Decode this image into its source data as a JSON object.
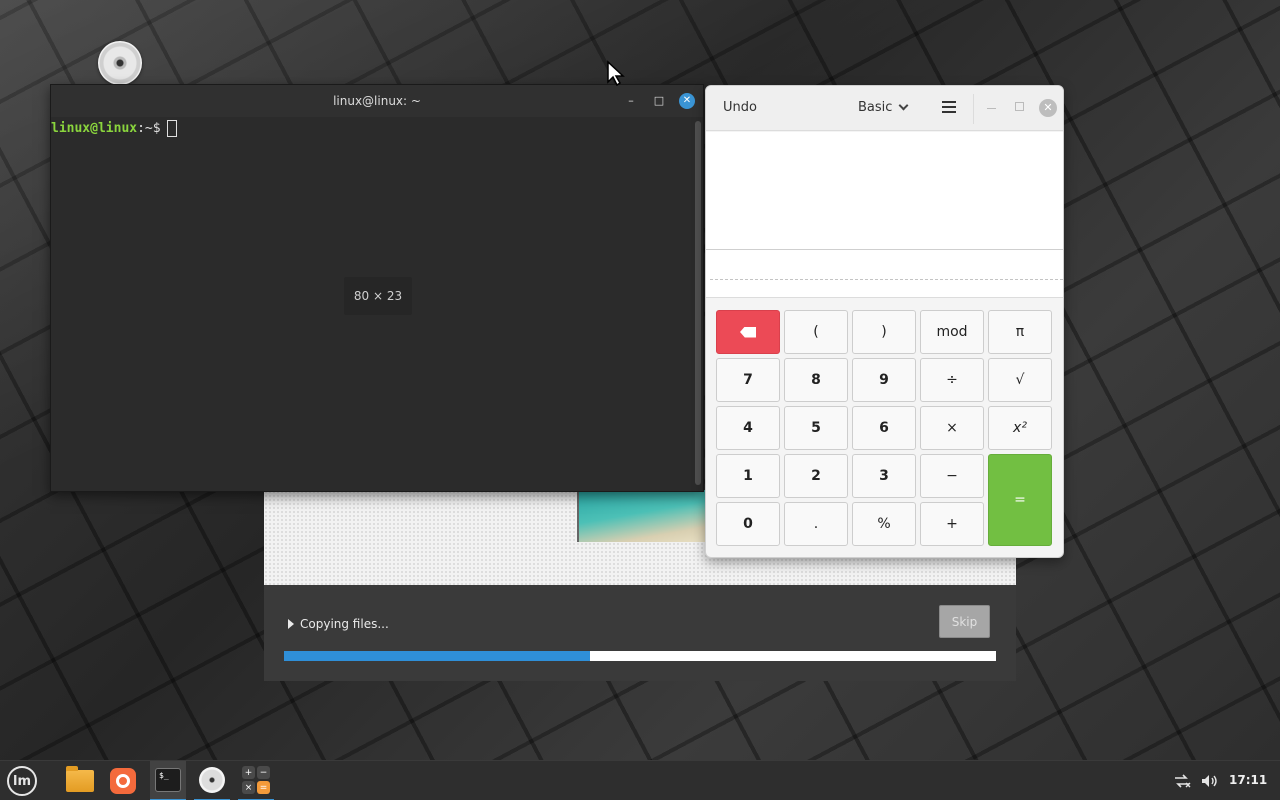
{
  "desktop": {
    "icons": [
      "disc-icon"
    ]
  },
  "copy_dialog": {
    "status_label": "Copying files...",
    "skip_label": "Skip",
    "progress": 0.43,
    "progress_color": "#2f8fd8"
  },
  "terminal": {
    "title": "linux@linux: ~",
    "minimize": "–",
    "maximize": "□",
    "close": "✕",
    "prompt_user": "linux@linux",
    "prompt_rest": ":~$",
    "size_overlay": "80 × 23"
  },
  "calculator": {
    "undo_label": "Undo",
    "mode_label": "Basic",
    "close": "✕",
    "keys": {
      "open_paren": "(",
      "close_paren": ")",
      "mod": "mod",
      "pi": "π",
      "k7": "7",
      "k8": "8",
      "k9": "9",
      "divide": "÷",
      "sqrt": "√",
      "k4": "4",
      "k5": "5",
      "k6": "6",
      "multiply": "×",
      "square": "x²",
      "k1": "1",
      "k2": "2",
      "k3": "3",
      "minus": "−",
      "equals": "=",
      "k0": "0",
      "point": ".",
      "percent": "%",
      "plus": "+"
    },
    "colors": {
      "backspace": "#ec4a56",
      "equals": "#72bf42"
    }
  },
  "taskbar": {
    "menu_label": "lm",
    "apps": [
      "files-icon",
      "firefox-icon",
      "terminal-icon",
      "disc-icon",
      "calculator-icon"
    ],
    "terminal_glyph": "$_",
    "calc_glyphs": [
      "+",
      "−",
      "×",
      "="
    ],
    "clock": "17:11"
  }
}
